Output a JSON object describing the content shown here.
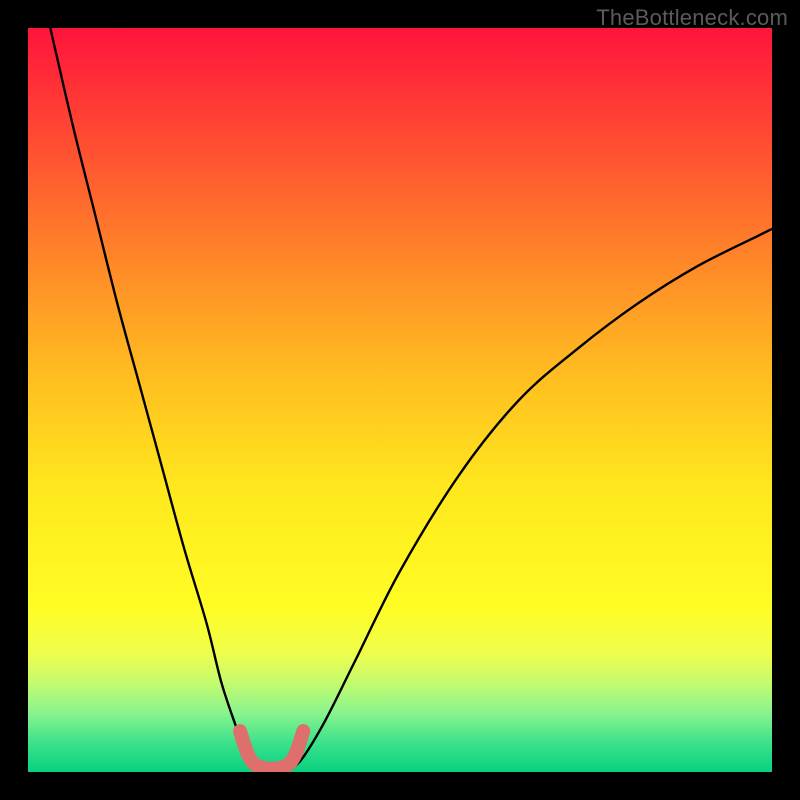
{
  "attribution": "TheBottleneck.com",
  "chart_data": {
    "type": "line",
    "title": "",
    "xlabel": "",
    "ylabel": "",
    "xlim": [
      0,
      100
    ],
    "ylim": [
      0,
      100
    ],
    "background_gradient": {
      "top": "#ff143c",
      "mid": "#fffd25",
      "bottom": "#06d17e",
      "meaning": "red = high bottleneck, green = low bottleneck"
    },
    "series": [
      {
        "name": "bottleneck-left-branch",
        "stroke": "#000000",
        "x": [
          3,
          6,
          9,
          12,
          15,
          18,
          21,
          24,
          26,
          28,
          29.5,
          30.3
        ],
        "values": [
          100,
          87,
          75,
          63,
          52,
          41,
          30,
          20,
          12,
          6,
          2,
          0.5
        ]
      },
      {
        "name": "bottleneck-right-branch",
        "stroke": "#000000",
        "x": [
          35.5,
          37,
          40,
          44,
          50,
          58,
          66,
          74,
          82,
          90,
          98,
          100
        ],
        "values": [
          0.5,
          2,
          7,
          15,
          27,
          40,
          50,
          57,
          63,
          68,
          72,
          73
        ]
      },
      {
        "name": "optimal-min-marker",
        "stroke": "#df6f6c",
        "x": [
          28.5,
          29.5,
          30.5,
          32,
          33.5,
          35,
          36,
          37
        ],
        "values": [
          5.5,
          2.5,
          1,
          0.5,
          0.5,
          1,
          2.5,
          5.5
        ]
      }
    ],
    "annotations": []
  }
}
